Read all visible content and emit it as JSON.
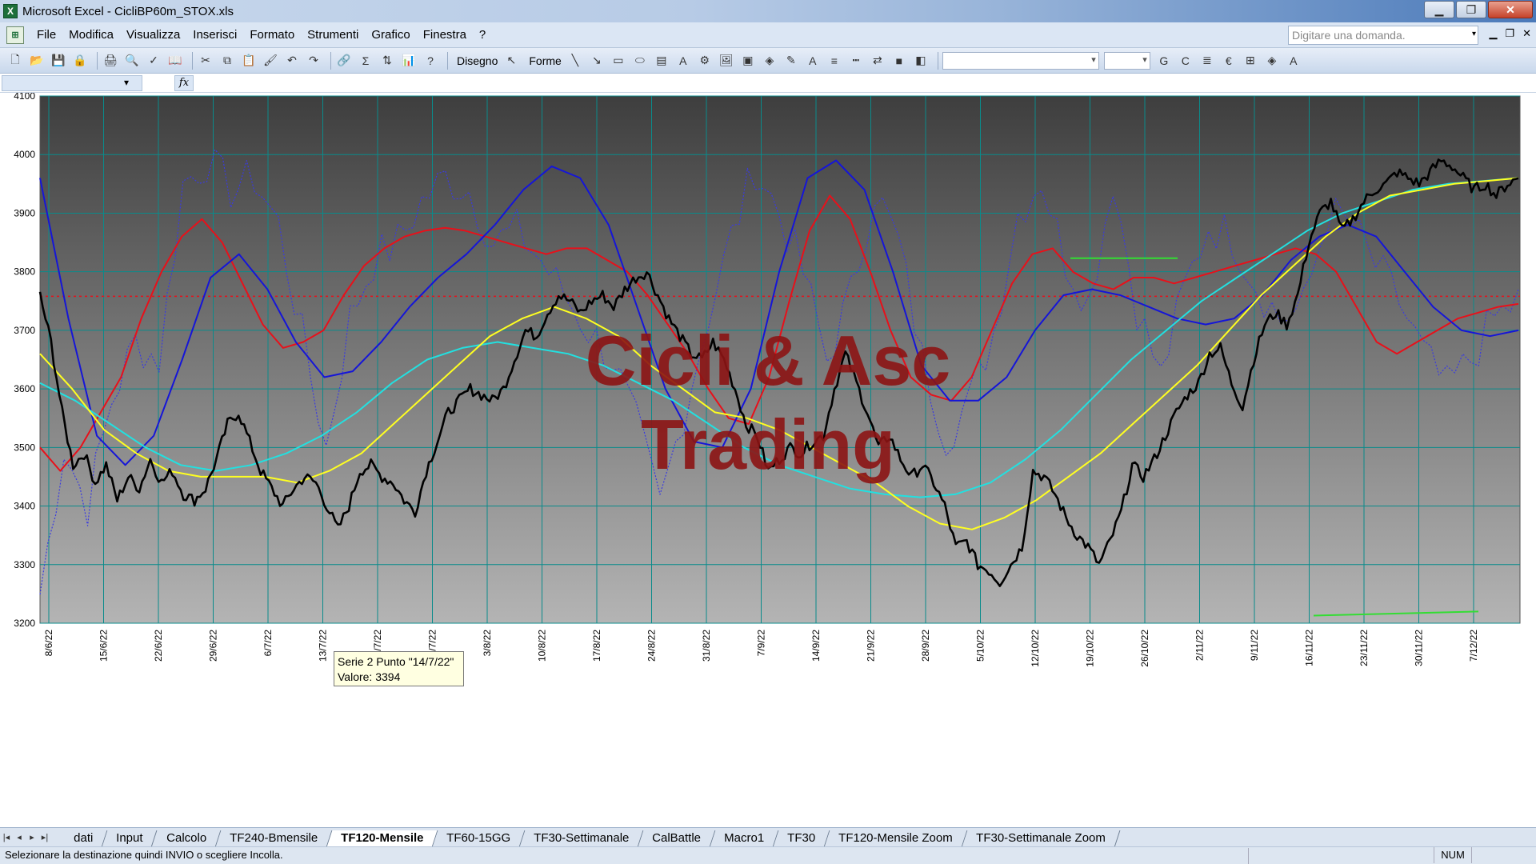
{
  "window": {
    "title": "Microsoft Excel - CicliBP60m_STOX.xls",
    "icon": "excel-app-icon",
    "min_glyph": "▁",
    "max_glyph": "❐",
    "close_glyph": "✕"
  },
  "menu": {
    "items": [
      {
        "label": "File",
        "accel": "F"
      },
      {
        "label": "Modifica",
        "accel": "M"
      },
      {
        "label": "Visualizza",
        "accel": "V"
      },
      {
        "label": "Inserisci",
        "accel": "I"
      },
      {
        "label": "Formato",
        "accel": "o"
      },
      {
        "label": "Strumenti",
        "accel": "S"
      },
      {
        "label": "Grafico",
        "accel": "G"
      },
      {
        "label": "Finestra",
        "accel": "n"
      },
      {
        "label": "?",
        "accel": "?"
      }
    ],
    "question_placeholder": "Digitare una domanda."
  },
  "toolbar": {
    "disegno_label": "Disegno",
    "forme_label": "Forme",
    "bold_label": "G",
    "italic_label": "C",
    "euro_label": "€"
  },
  "chart": {
    "watermark_line1": "Cicli & Asc",
    "watermark_line2": "Trading",
    "colors": {
      "plot_top": "#3e3e3e",
      "plot_bottom": "#b4b4b4",
      "grid": "#0a8b8b",
      "price": "#000000",
      "cycle_red": "#e8101a",
      "cycle_blue": "#1515d8",
      "oscillator_dotted": "#3a3ae0",
      "ma_yellow": "#ffff20",
      "ma_cyan": "#22e0e0",
      "watermark": "#8c1414"
    }
  },
  "chart_data": {
    "type": "line",
    "title": "",
    "xlabel": "",
    "ylabel": "",
    "ylim": [
      3200,
      4100
    ],
    "y_ticks": [
      3200,
      3300,
      3400,
      3500,
      3600,
      3700,
      3800,
      3900,
      4000,
      4100
    ],
    "x_ticks": [
      "8/6/22",
      "15/6/22",
      "22/6/22",
      "29/6/22",
      "6/7/22",
      "13/7/22",
      "20/7/22",
      "27/7/22",
      "3/8/22",
      "10/8/22",
      "17/8/22",
      "24/8/22",
      "31/8/22",
      "7/9/22",
      "14/9/22",
      "21/9/22",
      "28/9/22",
      "5/10/22",
      "12/10/22",
      "19/10/22",
      "26/10/22",
      "2/11/22",
      "9/11/22",
      "16/11/22",
      "23/11/22",
      "30/11/22",
      "7/12/22"
    ],
    "grid": true,
    "legend": "none",
    "hline_dotted_red": 3758,
    "series": [
      {
        "style": "price-black",
        "values": [
          3760,
          3680,
          3560,
          3470,
          3490,
          3440,
          3470,
          3410,
          3450,
          3430,
          3480,
          3440,
          3460,
          3420,
          3410,
          3430,
          3480,
          3540,
          3560,
          3510,
          3460,
          3430,
          3400,
          3430,
          3450,
          3440,
          3400,
          3360,
          3400,
          3460,
          3470,
          3450,
          3440,
          3410,
          3390,
          3460,
          3510,
          3560,
          3580,
          3600,
          3590,
          3580,
          3600,
          3650,
          3700,
          3690,
          3730,
          3760,
          3750,
          3730,
          3750,
          3760,
          3740,
          3770,
          3790,
          3800,
          3760,
          3720,
          3690,
          3660,
          3650,
          3680,
          3650,
          3600,
          3540,
          3520,
          3460,
          3480,
          3500,
          3490,
          3510,
          3520,
          3600,
          3660,
          3610,
          3560,
          3500,
          3520,
          3480,
          3450,
          3470,
          3440,
          3400,
          3330,
          3340,
          3300,
          3290,
          3270,
          3300,
          3330,
          3460,
          3450,
          3420,
          3380,
          3350,
          3330,
          3300,
          3340,
          3390,
          3470,
          3450,
          3480,
          3520,
          3560,
          3590,
          3610,
          3660,
          3670,
          3610,
          3570,
          3650,
          3710,
          3730,
          3710,
          3760,
          3850,
          3900,
          3920,
          3870,
          3890,
          3920,
          3940,
          3950,
          3970,
          3960,
          3950,
          3970,
          3990,
          3980,
          3960,
          3940,
          3950,
          3930,
          3950,
          3960
        ]
      },
      {
        "style": "cycle-red",
        "values": [
          3500,
          3460,
          3500,
          3560,
          3620,
          3720,
          3800,
          3860,
          3890,
          3850,
          3780,
          3710,
          3670,
          3680,
          3700,
          3760,
          3810,
          3840,
          3860,
          3870,
          3875,
          3870,
          3860,
          3850,
          3840,
          3830,
          3840,
          3840,
          3820,
          3800,
          3760,
          3710,
          3660,
          3600,
          3550,
          3540,
          3620,
          3750,
          3870,
          3930,
          3890,
          3800,
          3700,
          3620,
          3590,
          3580,
          3620,
          3700,
          3780,
          3830,
          3840,
          3800,
          3780,
          3770,
          3790,
          3790,
          3780,
          3790,
          3800,
          3810,
          3820,
          3830,
          3840,
          3830,
          3800,
          3740,
          3680,
          3660,
          3680,
          3700,
          3720,
          3730,
          3740,
          3745
        ]
      },
      {
        "style": "cycle-blue",
        "values": [
          3960,
          3720,
          3520,
          3470,
          3520,
          3650,
          3790,
          3830,
          3770,
          3680,
          3620,
          3630,
          3680,
          3740,
          3790,
          3830,
          3880,
          3940,
          3980,
          3960,
          3880,
          3740,
          3600,
          3510,
          3500,
          3600,
          3800,
          3960,
          3990,
          3940,
          3800,
          3640,
          3580,
          3580,
          3620,
          3700,
          3760,
          3770,
          3760,
          3740,
          3720,
          3710,
          3720,
          3760,
          3820,
          3860,
          3880,
          3860,
          3800,
          3740,
          3700,
          3690,
          3700
        ]
      },
      {
        "style": "oscillator-dotted",
        "values": [
          3250,
          3500,
          3400,
          3580,
          3680,
          3650,
          3950,
          3990,
          3940,
          3960,
          3880,
          3690,
          3500,
          3720,
          3820,
          3850,
          3920,
          3960,
          3940,
          3850,
          3870,
          3820,
          3760,
          3700,
          3650,
          3540,
          3400,
          3560,
          3720,
          3860,
          3980,
          3900,
          3800,
          3650,
          3760,
          3940,
          3850,
          3650,
          3520,
          3580,
          3700,
          3900,
          3960,
          3820,
          3750,
          3960,
          3740,
          3620,
          3770,
          3880,
          3860,
          3780,
          3720,
          3740,
          3900,
          3880,
          3810,
          3750,
          3660,
          3600,
          3650,
          3720,
          3750
        ]
      },
      {
        "style": "ma-yellow",
        "values": [
          3660,
          3600,
          3530,
          3490,
          3460,
          3450,
          3450,
          3450,
          3440,
          3460,
          3490,
          3540,
          3590,
          3640,
          3690,
          3720,
          3740,
          3720,
          3690,
          3640,
          3600,
          3560,
          3550,
          3530,
          3500,
          3470,
          3440,
          3400,
          3370,
          3360,
          3380,
          3410,
          3450,
          3490,
          3540,
          3590,
          3640,
          3700,
          3760,
          3810,
          3860,
          3900,
          3930,
          3940,
          3950,
          3955,
          3960
        ]
      },
      {
        "style": "ma-cyan",
        "values": [
          3610,
          3580,
          3540,
          3500,
          3470,
          3460,
          3470,
          3490,
          3520,
          3560,
          3610,
          3650,
          3670,
          3680,
          3670,
          3660,
          3640,
          3610,
          3580,
          3540,
          3500,
          3470,
          3450,
          3430,
          3420,
          3415,
          3420,
          3440,
          3480,
          3530,
          3590,
          3650,
          3700,
          3750,
          3790,
          3830,
          3870,
          3900,
          3920,
          3940,
          3950,
          3955,
          3960
        ]
      },
      {
        "style": "green-level-1",
        "values": [
          3823,
          3823
        ]
      },
      {
        "style": "green-level-2",
        "values": [
          3213,
          3220
        ]
      }
    ]
  },
  "tooltip": {
    "line1": "Serie 2 Punto \"14/7/22\"",
    "line2": "Valore: 3394"
  },
  "sheets": {
    "tabs": [
      "dati",
      "Input",
      "Calcolo",
      "TF240-Bmensile",
      "TF120-Mensile",
      "TF60-15GG",
      "TF30-Settimanale",
      "CalBattle",
      "Macro1",
      "TF30",
      "TF120-Mensile Zoom",
      "TF30-Settimanale Zoom"
    ],
    "active": "TF120-Mensile"
  },
  "status": {
    "message": "Selezionare la destinazione quindi INVIO o scegliere Incolla.",
    "num": "NUM"
  }
}
